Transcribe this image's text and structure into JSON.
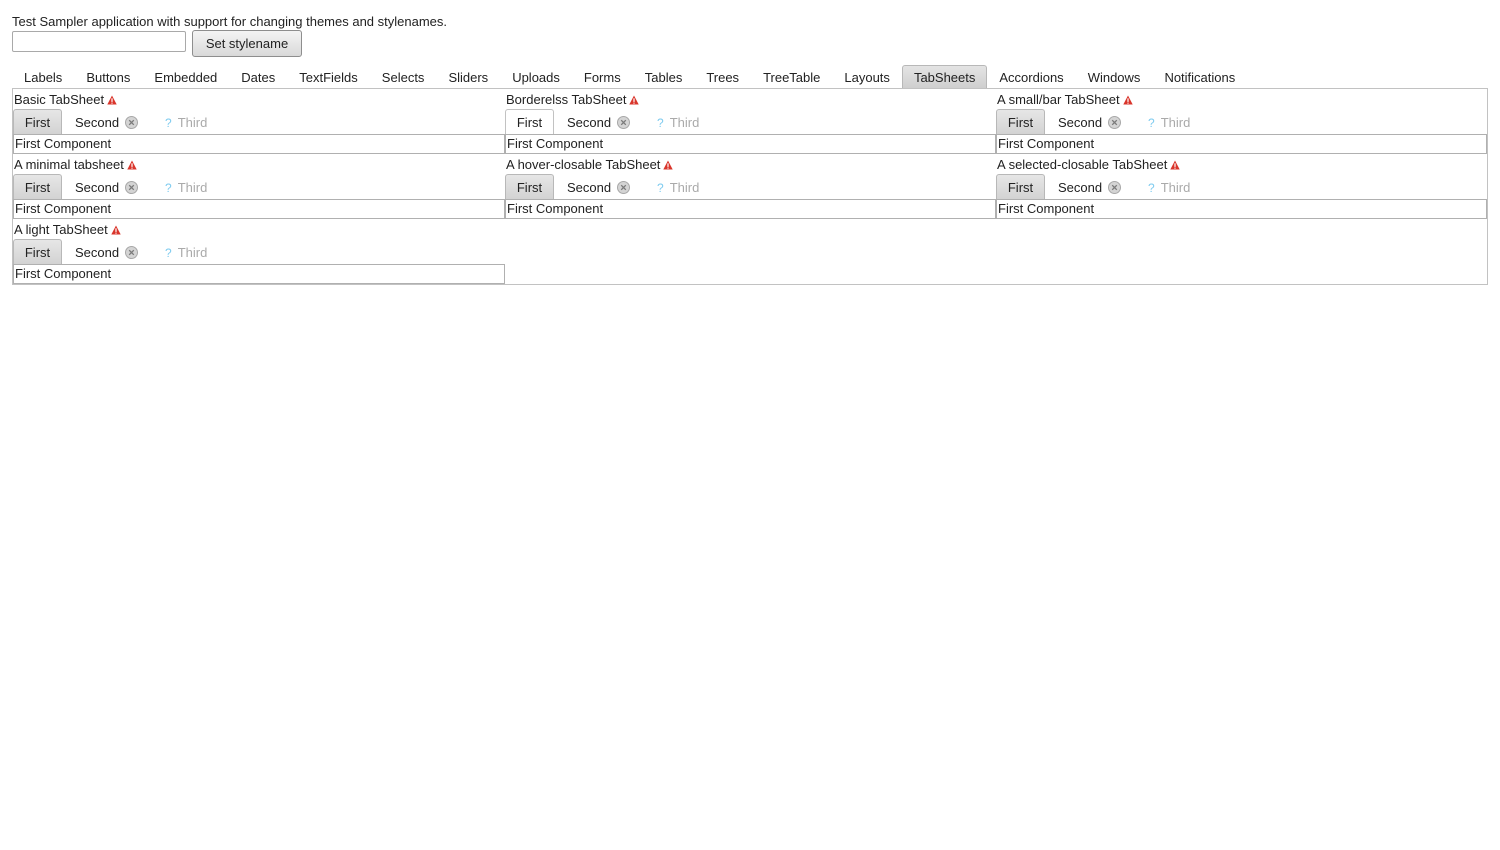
{
  "header": {
    "description": "Test Sampler application with support for changing themes and stylenames.",
    "stylename_input_value": "",
    "stylename_input_placeholder": "",
    "set_stylename_label": "Set stylename"
  },
  "main_tabs": [
    {
      "label": "Labels",
      "selected": false
    },
    {
      "label": "Buttons",
      "selected": false
    },
    {
      "label": "Embedded",
      "selected": false
    },
    {
      "label": "Dates",
      "selected": false
    },
    {
      "label": "TextFields",
      "selected": false
    },
    {
      "label": "Selects",
      "selected": false
    },
    {
      "label": "Sliders",
      "selected": false
    },
    {
      "label": "Uploads",
      "selected": false
    },
    {
      "label": "Forms",
      "selected": false
    },
    {
      "label": "Tables",
      "selected": false
    },
    {
      "label": "Trees",
      "selected": false
    },
    {
      "label": "TreeTable",
      "selected": false
    },
    {
      "label": "Layouts",
      "selected": false
    },
    {
      "label": "TabSheets",
      "selected": true
    },
    {
      "label": "Accordions",
      "selected": false
    },
    {
      "label": "Windows",
      "selected": false
    },
    {
      "label": "Notifications",
      "selected": false
    }
  ],
  "tabsheets": [
    {
      "caption": "Basic TabSheet",
      "tabs": {
        "first": "First",
        "second": "Second",
        "third": "Third"
      },
      "content": "First Component",
      "caption_icon": "warning-icon"
    },
    {
      "caption": "Borderelss TabSheet",
      "tabs": {
        "first": "First",
        "second": "Second",
        "third": "Third"
      },
      "content": "First Component",
      "caption_icon": "warning-icon"
    },
    {
      "caption": "A small/bar TabSheet",
      "tabs": {
        "first": "First",
        "second": "Second",
        "third": "Third"
      },
      "content": "First Component",
      "caption_icon": "warning-icon"
    },
    {
      "caption": "A minimal tabsheet",
      "tabs": {
        "first": "First",
        "second": "Second",
        "third": "Third"
      },
      "content": "First Component",
      "caption_icon": "warning-icon"
    },
    {
      "caption": "A hover-closable TabSheet",
      "tabs": {
        "first": "First",
        "second": "Second",
        "third": "Third"
      },
      "content": "First Component",
      "caption_icon": "warning-icon"
    },
    {
      "caption": "A selected-closable TabSheet",
      "tabs": {
        "first": "First",
        "second": "Second",
        "third": "Third"
      },
      "content": "First Component",
      "caption_icon": "warning-icon"
    },
    {
      "caption": "A light TabSheet",
      "tabs": {
        "first": "First",
        "second": "Second",
        "third": "Third"
      },
      "content": "First Component",
      "caption_icon": "warning-icon"
    }
  ],
  "icons": {
    "caption": "warning-icon",
    "close": "close-icon",
    "third_tab": "help-icon",
    "third_tab_glyph": "?"
  },
  "colors": {
    "warning": "#d9352b",
    "disabled_text": "#aaaaaa",
    "help_icon": "#7ecbef",
    "selected_tab": "#d8d8d8"
  }
}
